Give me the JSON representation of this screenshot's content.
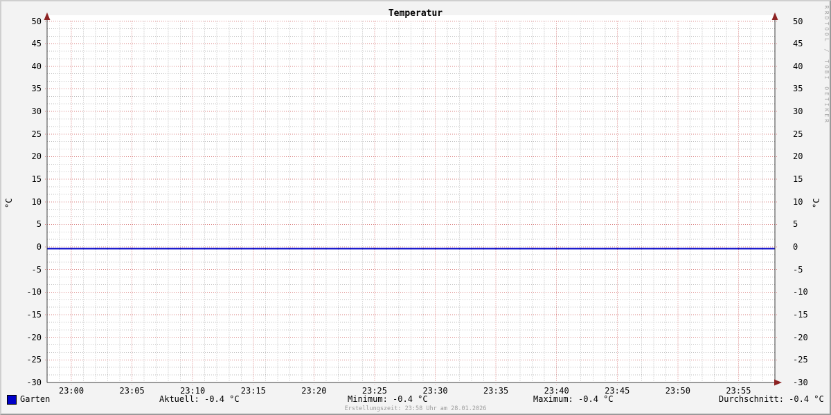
{
  "header": {
    "title": "Temperatur"
  },
  "watermark": "RRDTOOL / TOBI OETIKER",
  "axes": {
    "unit_left": "°C",
    "unit_right": "°C"
  },
  "legend": {
    "series_label": "Garten",
    "aktuell": "Aktuell: -0.4 °C",
    "minimum": "Minimum: -0.4 °C",
    "maximum": "Maximum: -0.4 °C",
    "durchschnitt": "Durchschnitt: -0.4 °C"
  },
  "footer": {
    "creation": "Erstellungszeit: 23:58 Uhr am 28.01.2026"
  },
  "colors": {
    "background": "#f3f3f3",
    "canvas": "#ffffff",
    "axis": "#3c3c3c",
    "arrow": "#8d2323",
    "grid_major": "#d97c7c",
    "grid_minor": "#bdbdbd",
    "series": "#0000c8"
  },
  "chart_data": {
    "type": "line",
    "title": "Temperatur",
    "ylabel": "°C",
    "ylim": [
      -30,
      50
    ],
    "y_tick_step": 5,
    "y_ticks": [
      -30,
      -25,
      -20,
      -15,
      -10,
      -5,
      0,
      5,
      10,
      15,
      20,
      25,
      30,
      35,
      40,
      45,
      50
    ],
    "y_minor_divisions": 3,
    "x_axis": {
      "total_minutes": 60,
      "minor_step_min": 1,
      "end_time": "23:58"
    },
    "x_ticks": [
      {
        "label": "23:00",
        "min": 2
      },
      {
        "label": "23:05",
        "min": 7
      },
      {
        "label": "23:10",
        "min": 12
      },
      {
        "label": "23:15",
        "min": 17
      },
      {
        "label": "23:20",
        "min": 22
      },
      {
        "label": "23:25",
        "min": 27
      },
      {
        "label": "23:30",
        "min": 32
      },
      {
        "label": "23:35",
        "min": 37
      },
      {
        "label": "23:40",
        "min": 42
      },
      {
        "label": "23:45",
        "min": 47
      },
      {
        "label": "23:50",
        "min": 52
      },
      {
        "label": "23:55",
        "min": 57
      }
    ],
    "series": [
      {
        "name": "Garten",
        "color": "#0000c8",
        "value": -0.4,
        "unit": "°C",
        "stats": {
          "aktuell": -0.4,
          "minimum": -0.4,
          "maximum": -0.4,
          "durchschnitt": -0.4
        }
      }
    ],
    "grid": true,
    "legend_position": "bottom"
  }
}
